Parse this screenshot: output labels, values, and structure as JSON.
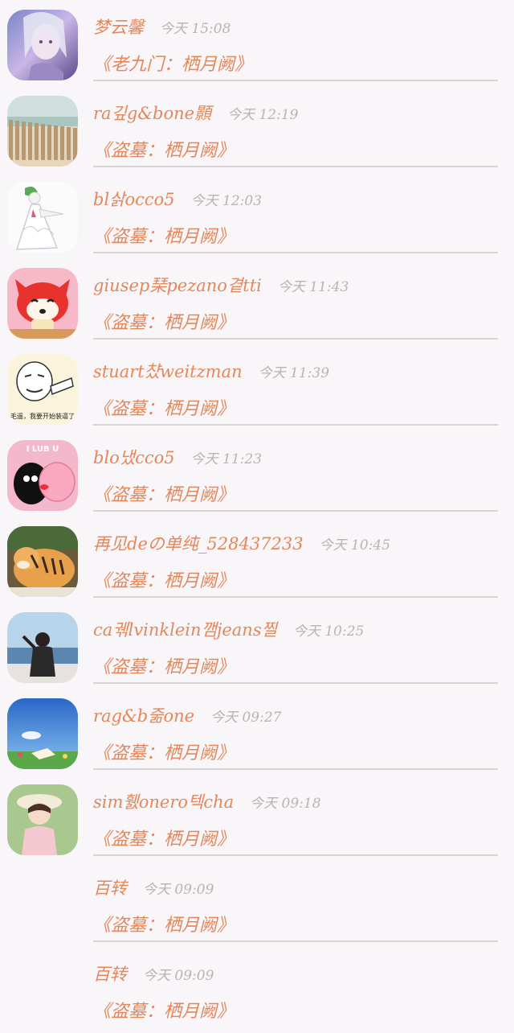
{
  "comments": [
    {
      "name": "梦云馨",
      "time": "今天 15:08",
      "message": "《老九门：栖月阙》",
      "avatar": "fantasy-woman-avatar"
    },
    {
      "name": "ra깊g&bone顥",
      "time": "今天 12:19",
      "message": "《盗墓：栖月阙》",
      "avatar": "beach-fence-avatar"
    },
    {
      "name": "bl삵occo5",
      "time": "今天 12:03",
      "message": "《盗墓：栖月阙》",
      "avatar": "white-pokemon-avatar"
    },
    {
      "name": "giusep琹pezano곁tti",
      "time": "今天 11:43",
      "message": "《盗墓：栖月阙》",
      "avatar": "red-fox-avatar"
    },
    {
      "name": "stuart챴weitzman",
      "time": "今天 11:39",
      "message": "《盗墓：栖月阙》",
      "avatar": "meme-face-avatar",
      "avatar_caption": "毛遥，我要开始装逼了"
    },
    {
      "name": "blo냈cco5",
      "time": "今天 11:23",
      "message": "《盗墓：栖月阙》",
      "avatar": "cartoon-couple-avatar",
      "avatar_caption": "I LUB U"
    },
    {
      "name": "再见deの单纯_528437233",
      "time": "今天 10:45",
      "message": "《盗墓：栖月阙》",
      "avatar": "tiger-avatar"
    },
    {
      "name": "ca궦lvinklein깸jeans찔",
      "time": "今天 10:25",
      "message": "《盗墓：栖月阙》",
      "avatar": "seaside-girl-avatar"
    },
    {
      "name": "rag&b줆one",
      "time": "今天 09:27",
      "message": "《盗墓：栖月阙》",
      "avatar": "blue-sky-avatar"
    },
    {
      "name": "sim휈onero텍cha",
      "time": "今天 09:18",
      "message": "《盗墓：栖月阙》",
      "avatar": "girl-hat-avatar"
    },
    {
      "name": "百转",
      "time": "今天 09:09",
      "message": "《盗墓：栖月阙》",
      "avatar": ""
    },
    {
      "name": "百转",
      "time": "今天 09:09",
      "message": "《盗墓：栖月阙》",
      "avatar": ""
    }
  ],
  "colors": {
    "name": "#e4875a",
    "time": "#b8b4b4",
    "divider": "#d8d4d4",
    "background": "#f8f6f8"
  }
}
